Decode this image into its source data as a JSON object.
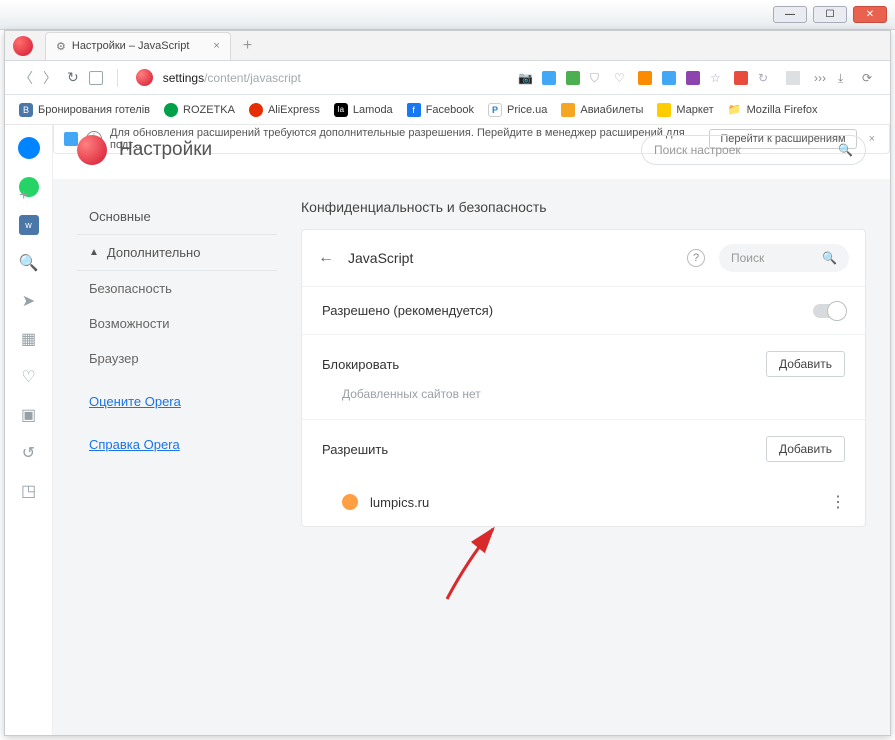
{
  "tab": {
    "title": "Настройки – JavaScript",
    "gear": "⚙"
  },
  "url": {
    "prefix": "settings",
    "path": "/content/javascript"
  },
  "bookmarks": [
    {
      "label": "Бронирования готелів",
      "icon": "vk"
    },
    {
      "label": "ROZETKA",
      "icon": "rz"
    },
    {
      "label": "AliExpress",
      "icon": "ae"
    },
    {
      "label": "Lamoda",
      "icon": "la"
    },
    {
      "label": "Facebook",
      "icon": "fb"
    },
    {
      "label": "Price.ua",
      "icon": "pr"
    },
    {
      "label": "Авиабилеты",
      "icon": "av"
    },
    {
      "label": "Маркет",
      "icon": "ym"
    },
    {
      "label": "Mozilla Firefox",
      "icon": "mf"
    }
  ],
  "notif": {
    "text": "Для обновления расширений требуются дополнительные разрешения. Перейдите в менеджер расширений для подт...",
    "button": "Перейти к расширениям"
  },
  "header": {
    "title": "Настройки",
    "search_placeholder": "Поиск настроек"
  },
  "leftnav": {
    "main": "Основные",
    "advanced": "Дополнительно",
    "security": "Безопасность",
    "features": "Возможности",
    "browser": "Браузер",
    "rate": "Оцените Opera",
    "help": "Справка Opera"
  },
  "section": {
    "title": "Конфиденциальность и безопасность"
  },
  "card": {
    "title": "JavaScript",
    "search_placeholder": "Поиск",
    "allowed_label": "Разрешено (рекомендуется)",
    "block_label": "Блокировать",
    "block_empty": "Добавленных сайтов нет",
    "allow_label": "Разрешить",
    "add_button": "Добавить",
    "site": "lumpics.ru"
  }
}
